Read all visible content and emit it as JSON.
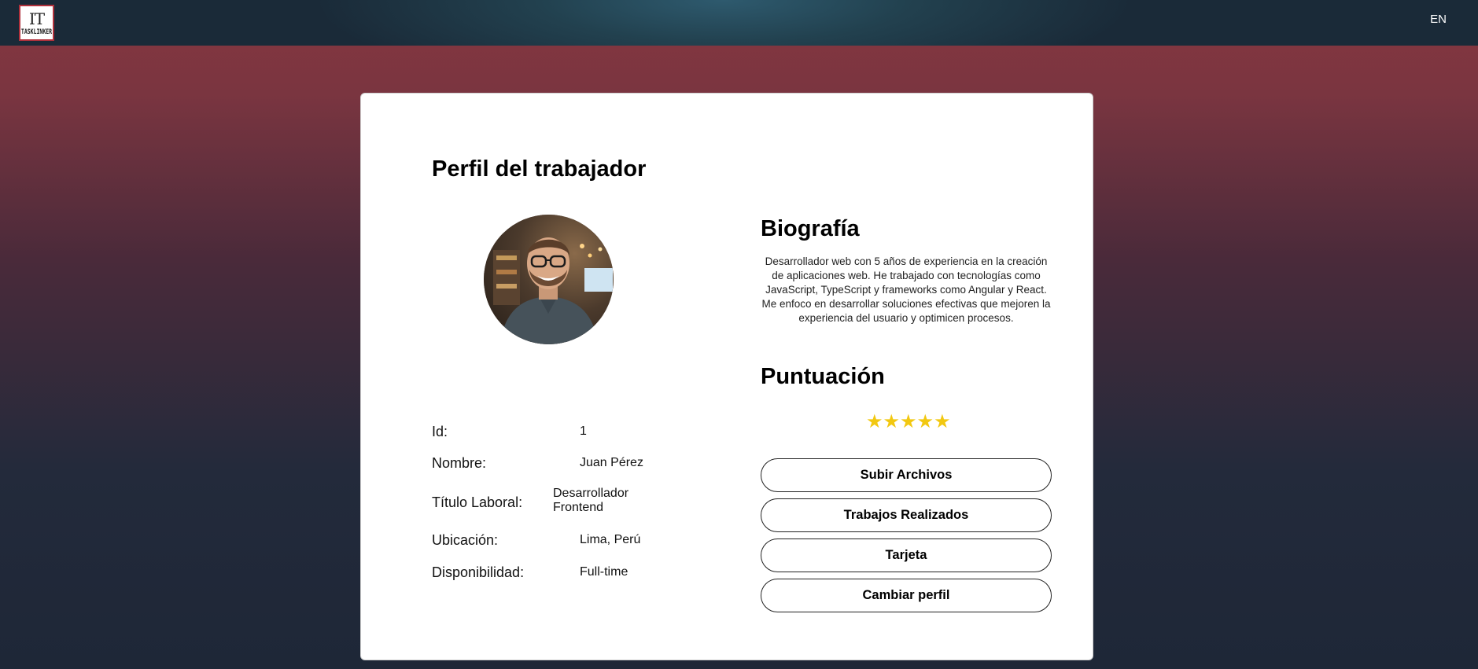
{
  "header": {
    "logo_mark": "IT",
    "logo_word": "TASKLINKER",
    "language": "EN"
  },
  "profile": {
    "title": "Perfil del trabajador",
    "fields": [
      {
        "label": "Id:",
        "value": "1"
      },
      {
        "label": "Nombre:",
        "value": "Juan Pérez"
      },
      {
        "label": "Título Laboral:",
        "value_line1": "Desarrollador",
        "value_line2": "Frontend"
      },
      {
        "label": "Ubicación:",
        "value": "Lima, Perú"
      },
      {
        "label": "Disponibilidad:",
        "value": "Full-time"
      }
    ]
  },
  "biography": {
    "title": "Biografía",
    "text": "Desarrollador web con 5 años de experiencia en la creación de aplicaciones web. He trabajado con tecnologías como JavaScript, TypeScript y frameworks como Angular y React. Me enfoco en desarrollar soluciones efectivas que mejoren la experiencia del usuario y optimicen procesos."
  },
  "rating": {
    "title": "Puntuación",
    "stars": 5,
    "max_stars": 5,
    "star_color": "#f2c811"
  },
  "actions": {
    "upload": "Subir Archivos",
    "works": "Trabajos Realizados",
    "card": "Tarjeta",
    "change_profile": "Cambiar perfil"
  },
  "colors": {
    "header_bg": "#1a2a38",
    "page_gradient_top": "#86363f",
    "page_gradient_bottom": "#1e2737"
  }
}
